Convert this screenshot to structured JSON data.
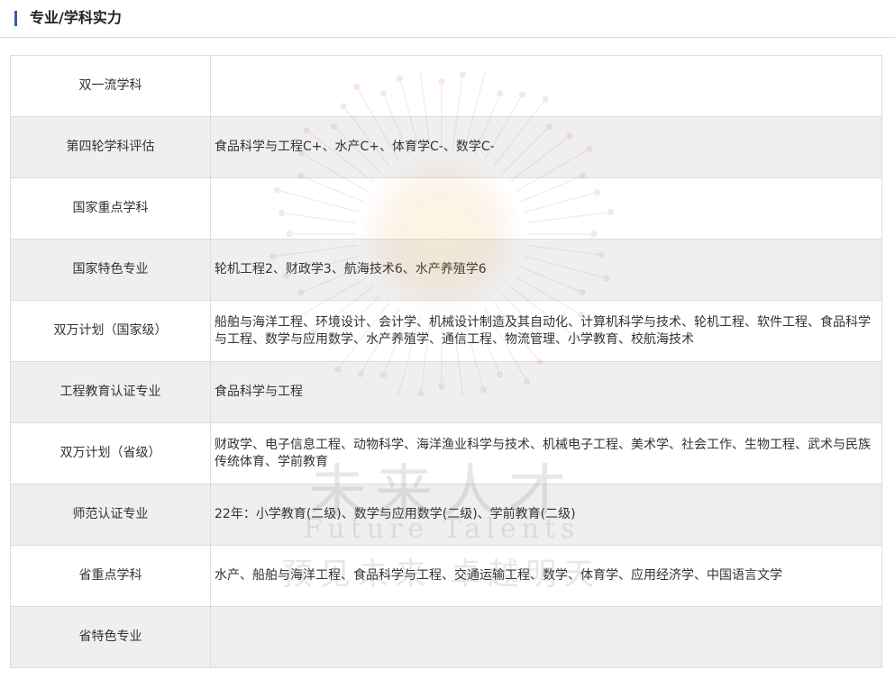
{
  "header": {
    "title": "专业/学科实力"
  },
  "colors": {
    "accent": "#3a5fa8",
    "row_alt": "#efefef",
    "border": "#dcdcdc"
  },
  "rows": [
    {
      "label": "双一流学科",
      "value": ""
    },
    {
      "label": "第四轮学科评估",
      "value": "食品科学与工程C+、水产C+、体育学C-、数学C-"
    },
    {
      "label": "国家重点学科",
      "value": ""
    },
    {
      "label": "国家特色专业",
      "value": "轮机工程2、财政学3、航海技术6、水产养殖学6"
    },
    {
      "label": "双万计划（国家级）",
      "value": "船舶与海洋工程、环境设计、会计学、机械设计制造及其自动化、计算机科学与技术、轮机工程、软件工程、食品科学与工程、数学与应用数学、水产养殖学、通信工程、物流管理、小学教育、校航海技术"
    },
    {
      "label": "工程教育认证专业",
      "value": "食品科学与工程"
    },
    {
      "label": "双万计划（省级）",
      "value": "财政学、电子信息工程、动物科学、海洋渔业科学与技术、机械电子工程、美术学、社会工作、生物工程、武术与民族传统体育、学前教育"
    },
    {
      "label": "师范认证专业",
      "value": "22年：小学教育(二级)、数学与应用数学(二级)、学前教育(二级)"
    },
    {
      "label": "省重点学科",
      "value": "水产、船舶与海洋工程、食品科学与工程、交通运输工程、数学、体育学、应用经济学、中国语言文学"
    },
    {
      "label": "省特色专业",
      "value": ""
    }
  ],
  "watermark": {
    "main": "未来人才",
    "latin": "Future Talents",
    "slogan": "预见未来 卓越明天"
  }
}
